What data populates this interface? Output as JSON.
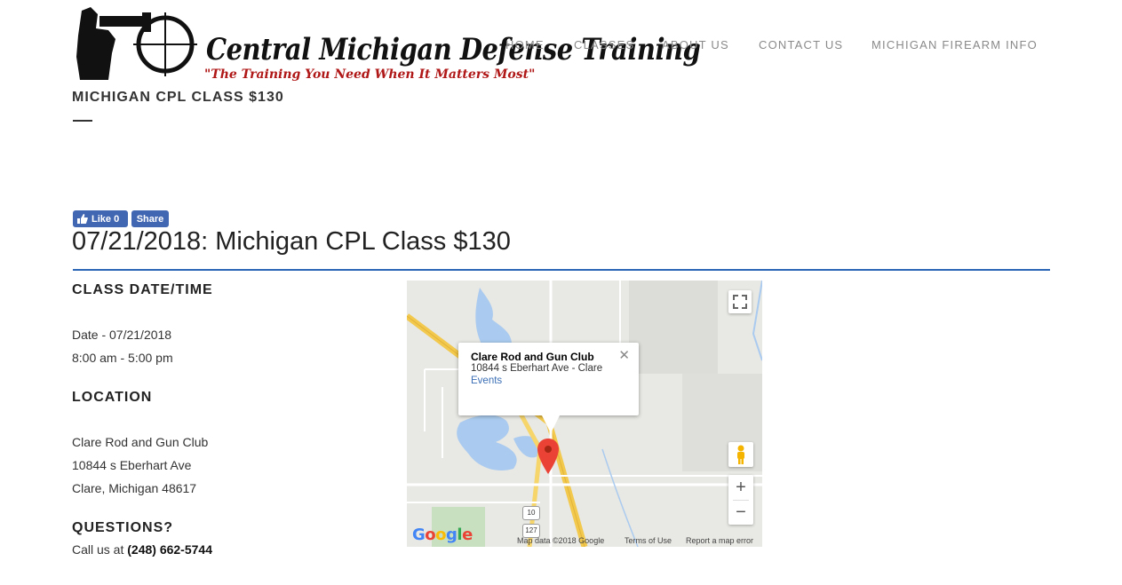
{
  "brand": {
    "name": "Central Michigan Defense Training",
    "tagline": "\"The Training You Need When It Matters Most\"",
    "colors": {
      "tagline": "#b01818",
      "accent_rule": "#2a66b5",
      "facebook": "#4267b2"
    }
  },
  "nav": {
    "items": [
      {
        "label": "HOME"
      },
      {
        "label": "CLASSES"
      },
      {
        "label": "ABOUT US"
      },
      {
        "label": "CONTACT US"
      },
      {
        "label": "MICHIGAN FIREARM INFO"
      }
    ]
  },
  "page": {
    "heading": "MICHIGAN CPL CLASS $130"
  },
  "social": {
    "like_label": "Like 0",
    "share_label": "Share"
  },
  "event": {
    "title": "07/21/2018: Michigan CPL Class $130",
    "datetime_heading": "CLASS DATE/TIME",
    "date_text": "Date - 07/21/2018",
    "time_text": "8:00 am - 5:00 pm",
    "location_heading": "LOCATION",
    "location_name": "Clare Rod and Gun Club",
    "location_street": "10844 s Eberhart Ave",
    "location_city": "Clare, Michigan 48617",
    "questions_heading": "QUESTIONS?",
    "call_prefix": "Call us at ",
    "phone": "(248) 662-5744"
  },
  "map": {
    "popup_title": "Clare Rod and Gun Club",
    "popup_address": "10844 s Eberhart Ave - Clare",
    "popup_link": "Events",
    "zoom_in": "+",
    "zoom_out": "−",
    "route_shield_1": "10",
    "route_shield_2": "127",
    "google_logo": "Google",
    "attribution": "Map data ©2018 Google",
    "terms": "Terms of Use",
    "report": "Report a map error"
  }
}
